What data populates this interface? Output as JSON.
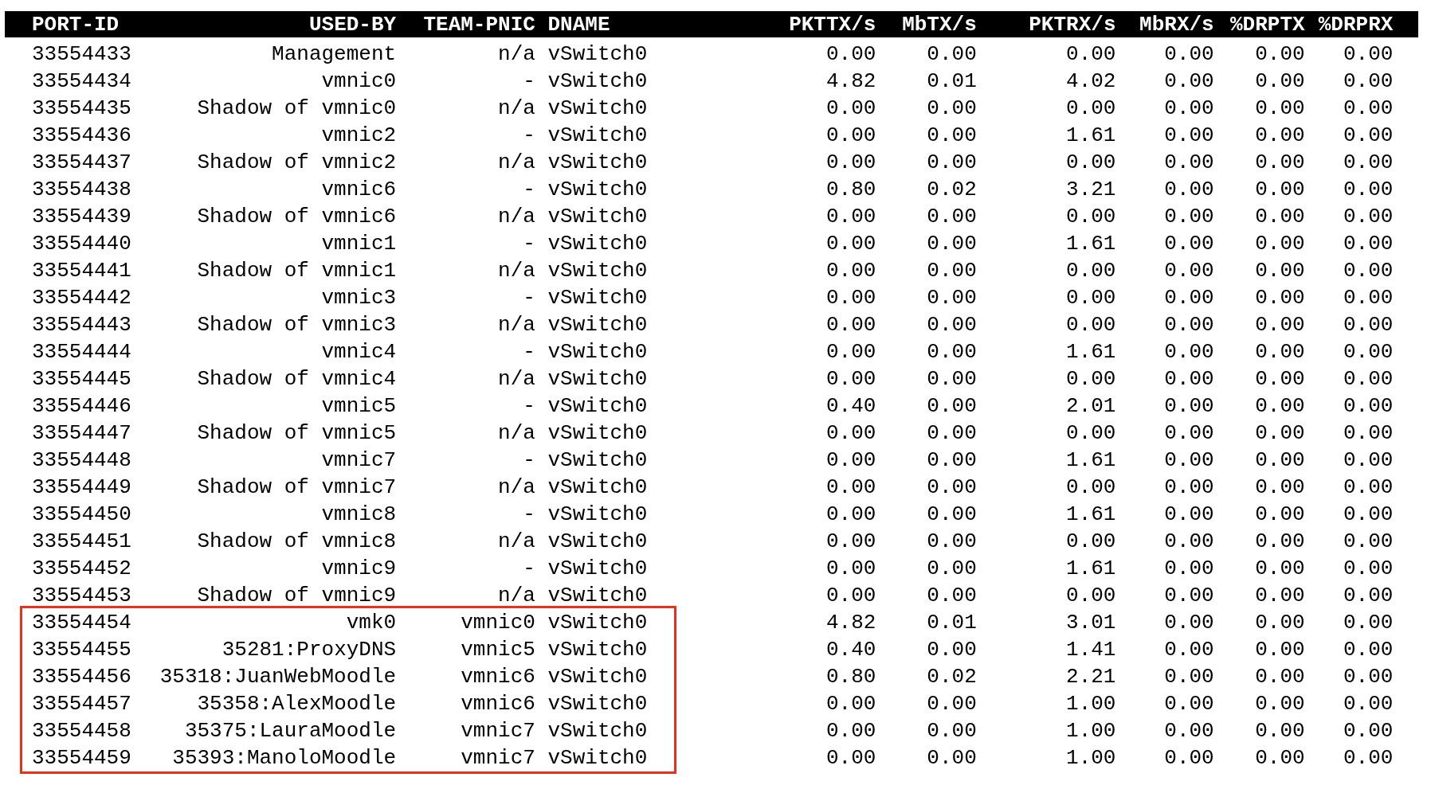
{
  "table": {
    "columns": [
      "PORT-ID",
      "USED-BY",
      "TEAM-PNIC",
      "DNAME",
      "PKTTX/s",
      "MbTX/s",
      "PKTRX/s",
      "MbRX/s",
      "%DRPTX",
      "%DRPRX"
    ],
    "rows": [
      {
        "cells": [
          "33554433",
          "Management",
          "n/a",
          "vSwitch0",
          "0.00",
          "0.00",
          "0.00",
          "0.00",
          "0.00",
          "0.00"
        ],
        "highlighted": false
      },
      {
        "cells": [
          "33554434",
          "vmnic0",
          "-",
          "vSwitch0",
          "4.82",
          "0.01",
          "4.02",
          "0.00",
          "0.00",
          "0.00"
        ],
        "highlighted": false
      },
      {
        "cells": [
          "33554435",
          "Shadow of vmnic0",
          "n/a",
          "vSwitch0",
          "0.00",
          "0.00",
          "0.00",
          "0.00",
          "0.00",
          "0.00"
        ],
        "highlighted": false
      },
      {
        "cells": [
          "33554436",
          "vmnic2",
          "-",
          "vSwitch0",
          "0.00",
          "0.00",
          "1.61",
          "0.00",
          "0.00",
          "0.00"
        ],
        "highlighted": false
      },
      {
        "cells": [
          "33554437",
          "Shadow of vmnic2",
          "n/a",
          "vSwitch0",
          "0.00",
          "0.00",
          "0.00",
          "0.00",
          "0.00",
          "0.00"
        ],
        "highlighted": false
      },
      {
        "cells": [
          "33554438",
          "vmnic6",
          "-",
          "vSwitch0",
          "0.80",
          "0.02",
          "3.21",
          "0.00",
          "0.00",
          "0.00"
        ],
        "highlighted": false
      },
      {
        "cells": [
          "33554439",
          "Shadow of vmnic6",
          "n/a",
          "vSwitch0",
          "0.00",
          "0.00",
          "0.00",
          "0.00",
          "0.00",
          "0.00"
        ],
        "highlighted": false
      },
      {
        "cells": [
          "33554440",
          "vmnic1",
          "-",
          "vSwitch0",
          "0.00",
          "0.00",
          "1.61",
          "0.00",
          "0.00",
          "0.00"
        ],
        "highlighted": false
      },
      {
        "cells": [
          "33554441",
          "Shadow of vmnic1",
          "n/a",
          "vSwitch0",
          "0.00",
          "0.00",
          "0.00",
          "0.00",
          "0.00",
          "0.00"
        ],
        "highlighted": false
      },
      {
        "cells": [
          "33554442",
          "vmnic3",
          "-",
          "vSwitch0",
          "0.00",
          "0.00",
          "0.00",
          "0.00",
          "0.00",
          "0.00"
        ],
        "highlighted": false
      },
      {
        "cells": [
          "33554443",
          "Shadow of vmnic3",
          "n/a",
          "vSwitch0",
          "0.00",
          "0.00",
          "0.00",
          "0.00",
          "0.00",
          "0.00"
        ],
        "highlighted": false
      },
      {
        "cells": [
          "33554444",
          "vmnic4",
          "-",
          "vSwitch0",
          "0.00",
          "0.00",
          "1.61",
          "0.00",
          "0.00",
          "0.00"
        ],
        "highlighted": false
      },
      {
        "cells": [
          "33554445",
          "Shadow of vmnic4",
          "n/a",
          "vSwitch0",
          "0.00",
          "0.00",
          "0.00",
          "0.00",
          "0.00",
          "0.00"
        ],
        "highlighted": false
      },
      {
        "cells": [
          "33554446",
          "vmnic5",
          "-",
          "vSwitch0",
          "0.40",
          "0.00",
          "2.01",
          "0.00",
          "0.00",
          "0.00"
        ],
        "highlighted": false
      },
      {
        "cells": [
          "33554447",
          "Shadow of vmnic5",
          "n/a",
          "vSwitch0",
          "0.00",
          "0.00",
          "0.00",
          "0.00",
          "0.00",
          "0.00"
        ],
        "highlighted": false
      },
      {
        "cells": [
          "33554448",
          "vmnic7",
          "-",
          "vSwitch0",
          "0.00",
          "0.00",
          "1.61",
          "0.00",
          "0.00",
          "0.00"
        ],
        "highlighted": false
      },
      {
        "cells": [
          "33554449",
          "Shadow of vmnic7",
          "n/a",
          "vSwitch0",
          "0.00",
          "0.00",
          "0.00",
          "0.00",
          "0.00",
          "0.00"
        ],
        "highlighted": false
      },
      {
        "cells": [
          "33554450",
          "vmnic8",
          "-",
          "vSwitch0",
          "0.00",
          "0.00",
          "1.61",
          "0.00",
          "0.00",
          "0.00"
        ],
        "highlighted": false
      },
      {
        "cells": [
          "33554451",
          "Shadow of vmnic8",
          "n/a",
          "vSwitch0",
          "0.00",
          "0.00",
          "0.00",
          "0.00",
          "0.00",
          "0.00"
        ],
        "highlighted": false
      },
      {
        "cells": [
          "33554452",
          "vmnic9",
          "-",
          "vSwitch0",
          "0.00",
          "0.00",
          "1.61",
          "0.00",
          "0.00",
          "0.00"
        ],
        "highlighted": false
      },
      {
        "cells": [
          "33554453",
          "Shadow of vmnic9",
          "n/a",
          "vSwitch0",
          "0.00",
          "0.00",
          "0.00",
          "0.00",
          "0.00",
          "0.00"
        ],
        "highlighted": false
      },
      {
        "cells": [
          "33554454",
          "vmk0",
          "vmnic0",
          "vSwitch0",
          "4.82",
          "0.01",
          "3.01",
          "0.00",
          "0.00",
          "0.00"
        ],
        "highlighted": true
      },
      {
        "cells": [
          "33554455",
          "35281:ProxyDNS",
          "vmnic5",
          "vSwitch0",
          "0.40",
          "0.00",
          "1.41",
          "0.00",
          "0.00",
          "0.00"
        ],
        "highlighted": true
      },
      {
        "cells": [
          "33554456",
          "35318:JuanWebMoodle",
          "vmnic6",
          "vSwitch0",
          "0.80",
          "0.02",
          "2.21",
          "0.00",
          "0.00",
          "0.00"
        ],
        "highlighted": true
      },
      {
        "cells": [
          "33554457",
          "35358:AlexMoodle",
          "vmnic6",
          "vSwitch0",
          "0.00",
          "0.00",
          "1.00",
          "0.00",
          "0.00",
          "0.00"
        ],
        "highlighted": true
      },
      {
        "cells": [
          "33554458",
          "35375:LauraMoodle",
          "vmnic7",
          "vSwitch0",
          "0.00",
          "0.00",
          "1.00",
          "0.00",
          "0.00",
          "0.00"
        ],
        "highlighted": true
      },
      {
        "cells": [
          "33554459",
          "35393:ManoloMoodle",
          "vmnic7",
          "vSwitch0",
          "0.00",
          "0.00",
          "1.00",
          "0.00",
          "0.00",
          "0.00"
        ],
        "highlighted": true
      }
    ]
  }
}
